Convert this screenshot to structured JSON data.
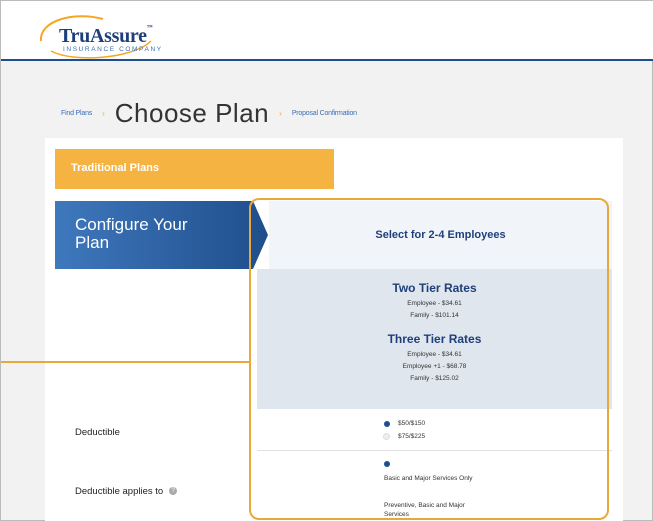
{
  "brand": {
    "name": "TruAssure",
    "tagline": "INSURANCE COMPANY"
  },
  "breadcrumb": {
    "step1": "Find Plans",
    "current": "Choose Plan",
    "step3": "Proposal Confirmation"
  },
  "plans": {
    "tab_label": "Traditional Plans",
    "config_label": "Configure Your Plan",
    "column_header": "Select for 2-4 Employees"
  },
  "rates": {
    "two_tier_title": "Two Tier Rates",
    "two_tier": [
      "Employee - $34.61",
      "Family - $101.14"
    ],
    "three_tier_title": "Three Tier Rates",
    "three_tier": [
      "Employee - $34.61",
      "Employee +1 - $68.78",
      "Family - $125.02"
    ]
  },
  "deductible": {
    "label": "Deductible",
    "options": [
      "$50/$150",
      "$75/$225"
    ],
    "selected": "$50/$150"
  },
  "deductible_applies": {
    "label": "Deductible applies to",
    "options": [
      "Basic and Major Services Only",
      "Preventive, Basic and Major Services"
    ],
    "selected": "Basic and Major Services Only"
  },
  "colors": {
    "accent": "#f5b342",
    "brand_blue": "#1f4e8c",
    "highlight": "#e8a93a"
  }
}
